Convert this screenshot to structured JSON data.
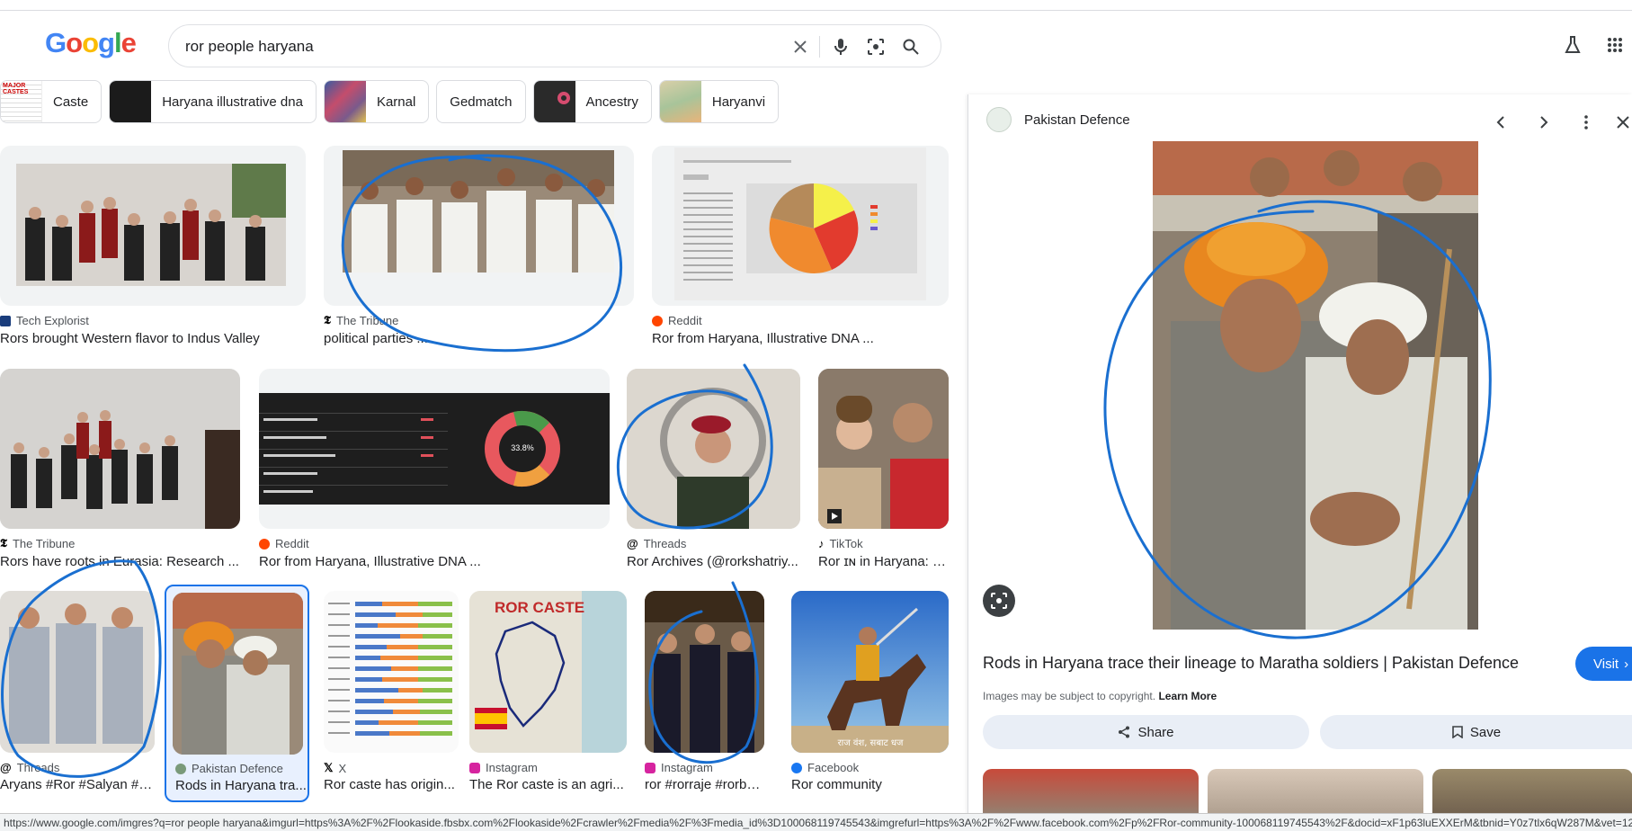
{
  "search": {
    "query": "ror people haryana"
  },
  "logo_text": "Google",
  "chips": [
    {
      "label": "Caste",
      "thumb_color": "#e8e8e8"
    },
    {
      "label": "Haryana illustrative dna",
      "thumb_color": "#1b1b1b"
    },
    {
      "label": "Karnal",
      "thumb_color": "#7a5a8c"
    },
    {
      "label": "Gedmatch",
      "thumb_color": ""
    },
    {
      "label": "Ancestry",
      "thumb_color": "#2a2a2a"
    },
    {
      "label": "Haryanvi",
      "thumb_color": "#c9b98e"
    }
  ],
  "results": [
    {
      "source": "Tech Explorist",
      "title": "Rors brought Western flavor to Indus Valley"
    },
    {
      "source": "The Tribune",
      "title": "political parties ..."
    },
    {
      "source": "Reddit",
      "title": "Ror from Haryana, Illustrative DNA ..."
    },
    {
      "source": "The Tribune",
      "title": "Rors have roots in Eurasia: Research ..."
    },
    {
      "source": "Reddit",
      "title": "Ror from Haryana, Illustrative DNA ..."
    },
    {
      "source": "Threads",
      "title": "Ror Archives (@rorkshatriy..."
    },
    {
      "source": "TikTok",
      "title": "Ror ɪɴ in Haryana: S..."
    },
    {
      "source": "Threads",
      "title": "Aryans #Ror #Salyan #S..."
    },
    {
      "source": "Pakistan Defence",
      "title": "Rods in Haryana tra..."
    },
    {
      "source": "X",
      "title": "Ror caste has origin..."
    },
    {
      "source": "Instagram",
      "title": "The Ror caste is an agri..."
    },
    {
      "source": "Instagram",
      "title": "ror #rorraje #rorboy..."
    },
    {
      "source": "Facebook",
      "title": "Ror community"
    }
  ],
  "image_text": {
    "donut_center": "33.8%",
    "ror_caste_map_title": "ROR CASTE",
    "painting_caption": "राज वंश, सबाट धज"
  },
  "panel": {
    "source": "Pakistan Defence",
    "title": "Rods in Haryana trace their lineage to Maratha soldiers | Pakistan Defence",
    "visit_label": "Visit",
    "copyright_text": "Images may be subject to copyright.",
    "learn_more": "Learn More",
    "share_label": "Share",
    "save_label": "Save"
  },
  "status_url": "https://www.google.com/imgres?q=ror people haryana&imgurl=https%3A%2F%2Flookaside.fbsbx.com%2Flookaside%2Fcrawler%2Fmedia%2F%3Fmedia_id%3D100068119745543&imgrefurl=https%3A%2F%2Fwww.facebook.com%2Fp%2FRor-community-100068119745543%2F&docid=xF1p63luEXXErM&tbnid=Y0z7tlx6qW287M&vet=12ahUKEw",
  "colors": {
    "accent": "#1a73e8",
    "annotation": "#1a6fd0"
  }
}
